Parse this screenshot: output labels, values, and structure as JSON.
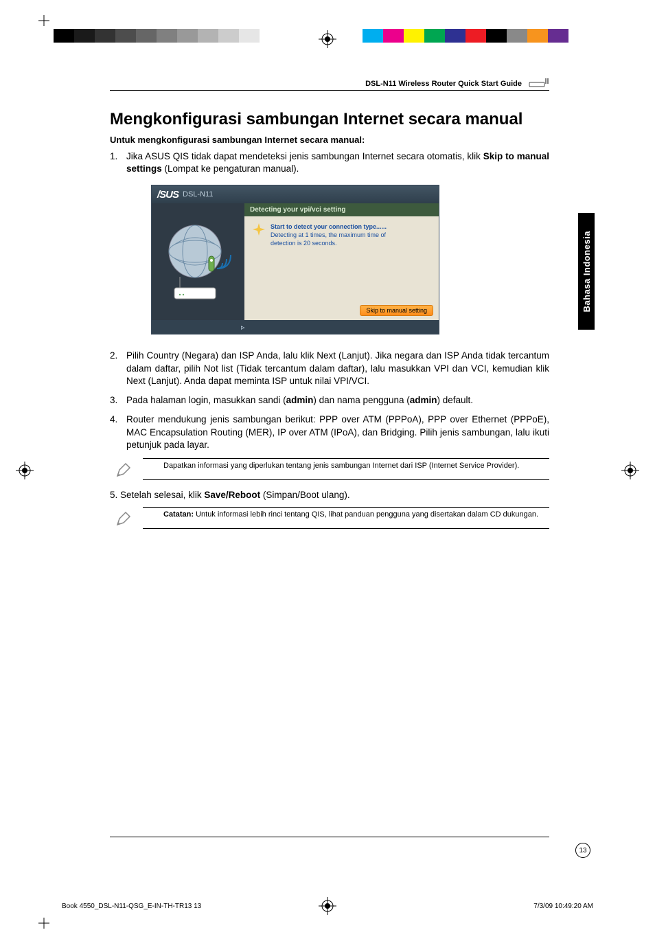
{
  "printer_marks": {
    "gray_scale": [
      "#000",
      "#1a1a1a",
      "#333",
      "#4d4d4d",
      "#666",
      "#808080",
      "#999",
      "#b3b3b3",
      "#ccc",
      "#e6e6e6"
    ],
    "color_scale": [
      "#00aeef",
      "#ec008c",
      "#fff200",
      "#00a651",
      "#2e3192",
      "#ed1c24",
      "#000000",
      "#898989",
      "#f7941e",
      "#662d91"
    ]
  },
  "header": {
    "running_title": "DSL-N11 Wireless Router Quick Start Guide"
  },
  "side_tab": "Bahasa Indonesia",
  "title": "Mengkonfigurasi sambungan Internet secara manual",
  "subhead": "Untuk mengkonfigurasi sambungan Internet secara manual:",
  "steps": {
    "s1_pre": "Jika ASUS QIS tidak dapat mendeteksi jenis sambungan Internet secara otomatis, klik ",
    "s1_bold": "Skip to manual settings",
    "s1_post": " (Lompat ke pengaturan manual).",
    "s2": "Pilih Country (Negara) dan ISP Anda, lalu klik Next (Lanjut). Jika negara dan ISP Anda tidak tercantum dalam daftar, pilih Not list (Tidak tercantum dalam daftar), lalu masukkan VPI dan VCI, kemudian klik Next (Lanjut). Anda dapat meminta ISP untuk nilai VPI/VCI.",
    "s3_pre": "Pada halaman login, masukkan sandi (",
    "s3_b1": "admin",
    "s3_mid": ") dan nama pengguna (",
    "s3_b2": "admin",
    "s3_post": ") default.",
    "s4": "Router mendukung jenis sambungan berikut: PPP over ATM (PPPoA), PPP over Ethernet (PPPoE), MAC Encapsulation Routing (MER), IP over ATM (IPoA), dan Bridging. Pilih jenis sambungan, lalu ikuti petunjuk pada layar.",
    "s5_pre": "5. Setelah selesai, klik ",
    "s5_bold": "Save/Reboot",
    "s5_post": " (Simpan/Boot ulang)."
  },
  "note1": "Dapatkan informasi yang diperlukan tentang jenis sambungan Internet dari ISP (Internet Service Provider).",
  "note2_bold": "Catatan:",
  "note2_rest": " Untuk informasi lebih rinci tentang QIS, lihat panduan pengguna yang disertakan dalam CD dukungan.",
  "screenshot": {
    "brand": "/SUS",
    "model": "DSL-N11",
    "bar": "Detecting your vpi/vci setting",
    "msg_l1": "Start to detect your connection type......",
    "msg_l2": "Detecting at 1 times, the maximum time of",
    "msg_l3": "detection is 20 seconds.",
    "skip_btn": "Skip to manual setting"
  },
  "page_number": "13",
  "meta": {
    "left": "Book 4550_DSL-N11-QSG_E-IN-TH-TR13   13",
    "right": "7/3/09   10:49:20 AM"
  }
}
